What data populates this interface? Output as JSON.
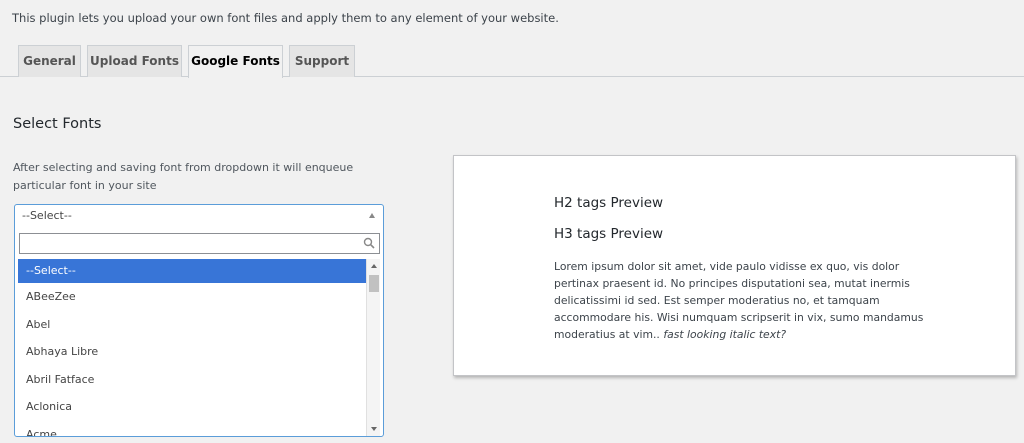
{
  "intro_text": "This plugin lets you upload your own font files and apply them to any element of your website.",
  "tabs": [
    {
      "label": "General",
      "active": false
    },
    {
      "label": "Upload Fonts",
      "active": false
    },
    {
      "label": "Google Fonts",
      "active": true
    },
    {
      "label": "Support",
      "active": false
    }
  ],
  "section_title": "Select Fonts",
  "help_text": "After selecting and saving font from dropdown it will enqueue particular font in your site",
  "select": {
    "current": "--Select--",
    "search_value": "",
    "options": [
      "--Select--",
      "ABeeZee",
      "Abel",
      "Abhaya Libre",
      "Abril Fatface",
      "Aclonica",
      "Acme"
    ],
    "selected_index": 0
  },
  "preview": {
    "h2": "H2 tags Preview",
    "h3": "H3 tags Preview",
    "body": "Lorem ipsum dolor sit amet, vide paulo vidisse ex quo, vis dolor pertinax praesent id. No principes disputationi sea, mutat inermis delicatissimi id sed. Est semper moderatius no, et tamquam accommodare his. Wisi numquam scripserit in vix, sumo mandamus moderatius at vim..",
    "italic": "fast looking italic text?"
  },
  "colors": {
    "accent": "#3875d7",
    "focus_border": "#5b9dd9"
  },
  "icons": {
    "search": "search-icon",
    "caret": "caret-up-icon"
  }
}
